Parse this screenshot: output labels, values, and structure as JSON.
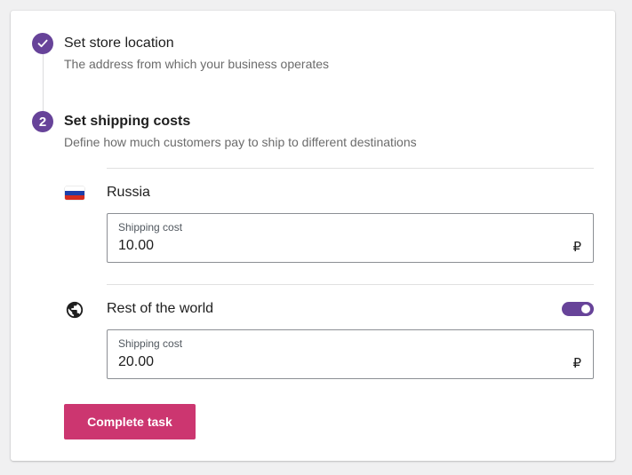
{
  "steps": [
    {
      "status": "complete",
      "icon": "check-icon",
      "title": "Set store location",
      "description": "The address from which your business operates"
    },
    {
      "status": "active",
      "number": "2",
      "title": "Set shipping costs",
      "description": "Define how much customers pay to ship to different destinations"
    }
  ],
  "shipping_zones": [
    {
      "name": "Russia",
      "icon": "russia-flag-icon",
      "field_label": "Shipping cost",
      "value": "10.00",
      "currency_symbol": "₽"
    },
    {
      "name": "Rest of the world",
      "icon": "globe-icon",
      "toggle_enabled": true,
      "field_label": "Shipping cost",
      "value": "20.00",
      "currency_symbol": "₽"
    }
  ],
  "complete_button_label": "Complete task",
  "colors": {
    "accent_purple": "#674399",
    "button_pink": "#cc3670",
    "flag_white": "#ffffff",
    "flag_blue": "#1c3faa",
    "flag_red": "#d52b1e"
  }
}
